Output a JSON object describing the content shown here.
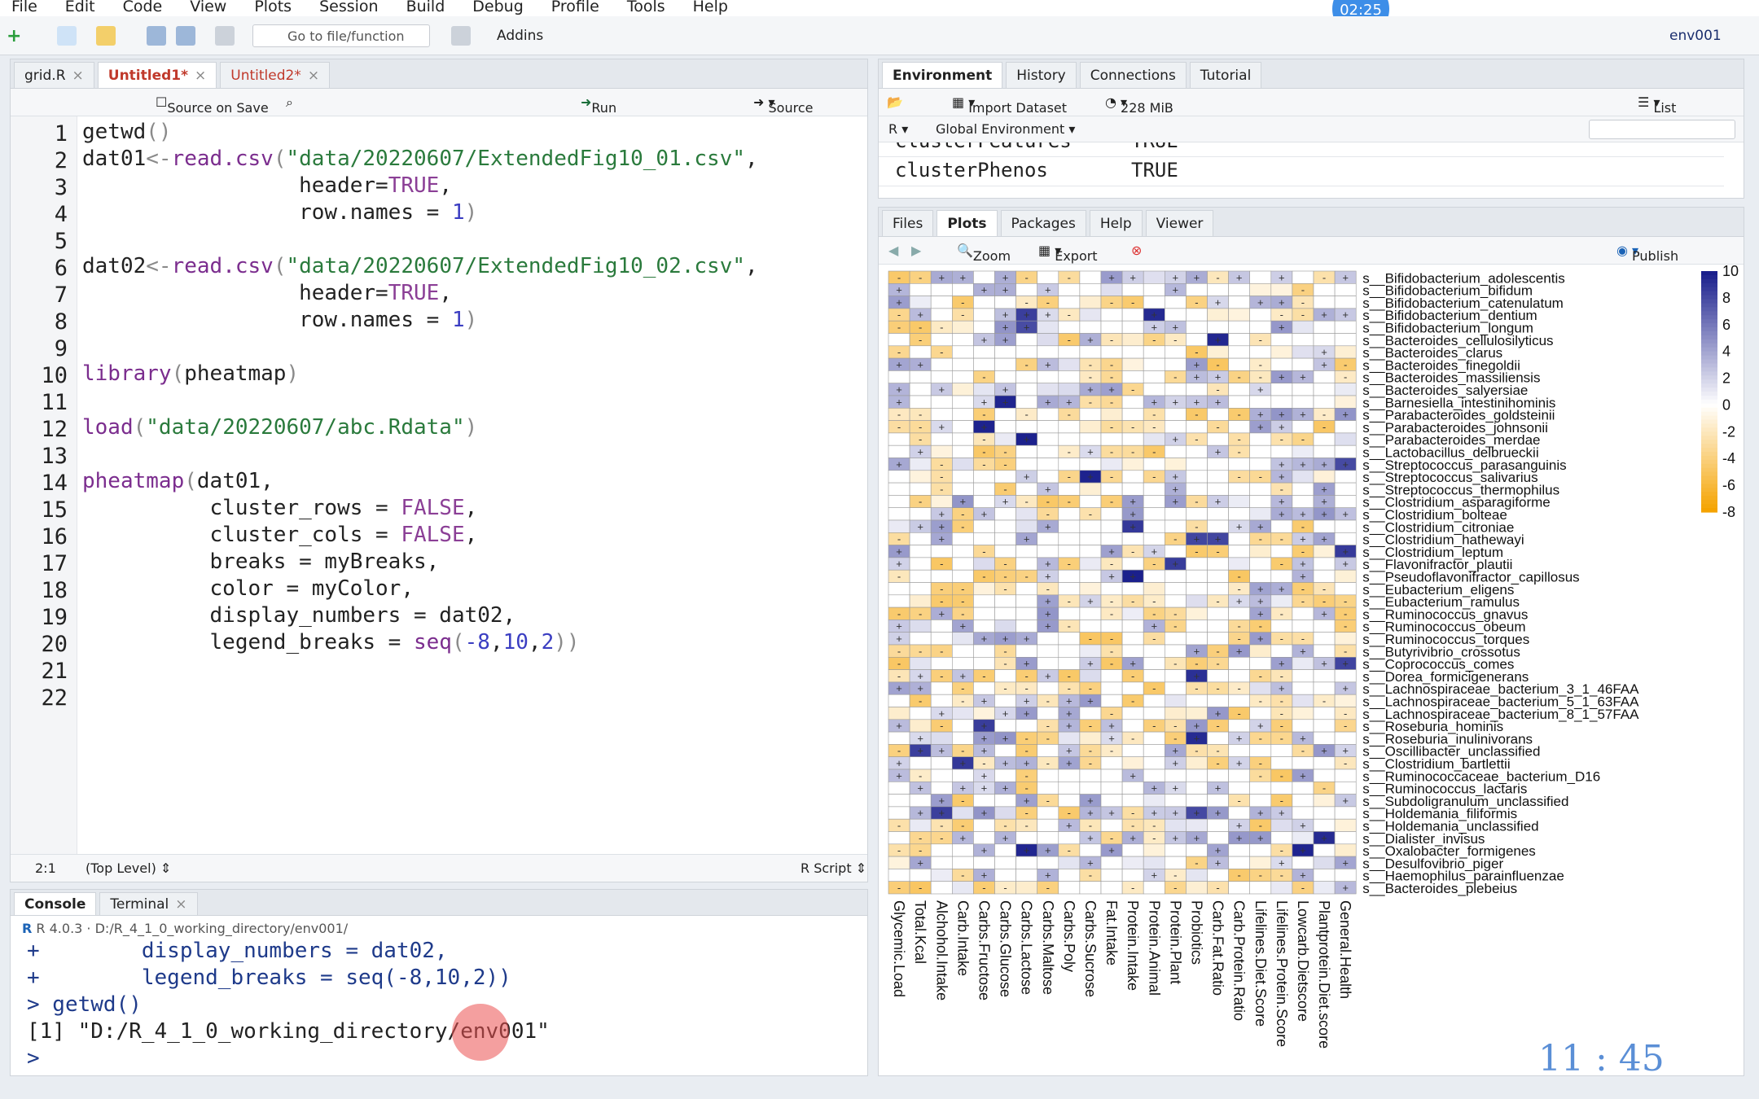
{
  "menu": [
    "File",
    "Edit",
    "Code",
    "View",
    "Plots",
    "Session",
    "Build",
    "Debug",
    "Profile",
    "Tools",
    "Help"
  ],
  "timer_badge": "02:25",
  "toolbar": {
    "goto_placeholder": "Go to file/function",
    "addins": "Addins",
    "project": "env001"
  },
  "editor": {
    "tabs": [
      {
        "label": "grid.R"
      },
      {
        "label": "Untitled1*"
      },
      {
        "label": "Untitled2*"
      }
    ],
    "source_on_save": "Source on Save",
    "run": "Run",
    "source": "Source",
    "status_pos": "2:1",
    "status_scope": "(Top Level)",
    "status_type": "R Script",
    "lines": [
      "1",
      "2",
      "3",
      "4",
      "5",
      "6",
      "7",
      "8",
      "9",
      "10",
      "11",
      "12",
      "13",
      "14",
      "15",
      "16",
      "17",
      "18",
      "19",
      "20",
      "21",
      "22"
    ]
  },
  "console": {
    "tab": "Console",
    "terminal": "Terminal",
    "version": "R 4.0.3",
    "path": "D:/R_4_1_0_working_directory/env001/",
    "lines": [
      "+        display_numbers = dat02,",
      "+        legend_breaks = seq(-8,10,2))",
      "> getwd()",
      "[1] \"D:/R_4_1_0_working_directory/env001\"",
      ">"
    ]
  },
  "env": {
    "tabs": [
      "Environment",
      "History",
      "Connections",
      "Tutorial"
    ],
    "import": "Import Dataset",
    "mem": "228 MiB",
    "list": "List",
    "lang": "R",
    "scope": "Global Environment",
    "rows": [
      {
        "name": "clusterFeatures",
        "value": "TRUE"
      },
      {
        "name": "clusterPhenos",
        "value": "TRUE"
      }
    ]
  },
  "files": {
    "tabs": [
      "Files",
      "Plots",
      "Packages",
      "Help",
      "Viewer"
    ],
    "zoom": "Zoom",
    "export": "Export",
    "publish": "Publish"
  },
  "clock": "11 : 45",
  "chart_data": {
    "type": "heatmap",
    "rows": [
      "s__Bifidobacterium_adolescentis",
      "s__Bifidobacterium_bifidum",
      "s__Bifidobacterium_catenulatum",
      "s__Bifidobacterium_dentium",
      "s__Bifidobacterium_longum",
      "s__Bacteroides_cellulosilyticus",
      "s__Bacteroides_clarus",
      "s__Bacteroides_finegoldii",
      "s__Bacteroides_massiliensis",
      "s__Bacteroides_salyersiae",
      "s__Barnesiella_intestinihominis",
      "s__Parabacteroides_goldsteinii",
      "s__Parabacteroides_johnsonii",
      "s__Parabacteroides_merdae",
      "s__Lactobacillus_delbrueckii",
      "s__Streptococcus_parasanguinis",
      "s__Streptococcus_salivarius",
      "s__Streptococcus_thermophilus",
      "s__Clostridium_asparagiforme",
      "s__Clostridium_bolteae",
      "s__Clostridium_citroniae",
      "s__Clostridium_hathewayi",
      "s__Clostridium_leptum",
      "s__Flavonifractor_plautii",
      "s__Pseudoflavonifractor_capillosus",
      "s__Eubacterium_eligens",
      "s__Eubacterium_ramulus",
      "s__Ruminococcus_gnavus",
      "s__Ruminococcus_obeum",
      "s__Ruminococcus_torques",
      "s__Butyrivibrio_crossotus",
      "s__Coprococcus_comes",
      "s__Dorea_formicigenerans",
      "s__Lachnospiraceae_bacterium_3_1_46FAA",
      "s__Lachnospiraceae_bacterium_5_1_63FAA",
      "s__Lachnospiraceae_bacterium_8_1_57FAA",
      "s__Roseburia_hominis",
      "s__Roseburia_inulinivorans",
      "s__Oscillibacter_unclassified",
      "s__Clostridium_bartlettii",
      "s__Ruminococcaceae_bacterium_D16",
      "s__Ruminococcus_lactaris",
      "s__Subdoligranulum_unclassified",
      "s__Holdemania_filiformis",
      "s__Holdemania_unclassified",
      "s__Dialister_invisus",
      "s__Oxalobacter_formigenes",
      "s__Desulfovibrio_piger",
      "s__Haemophilus_parainfluenzae",
      "s__Bacteroides_plebeius"
    ],
    "columns": [
      "Glycemic.Load",
      "Total.Kcal",
      "Alchohol.Intake",
      "Carb.Intake",
      "Carbs.Fructose",
      "Carbs.Glucose",
      "Carbs.Lactose",
      "Carbs.Maltose",
      "Carbs.Poly",
      "Carbs.Sucrose",
      "Fat.Intake",
      "Protein.Intake",
      "Protein.Animal",
      "Protein.Plant",
      "Probiotics",
      "Carb.Fat.Ratio",
      "Carb.Protein.Ratio",
      "Lifelines.Diet.Score",
      "Lifelines.Protein.Score",
      "Lowcarb.Dietscore",
      "Plantprotein.Diet.score",
      "General.Health"
    ],
    "legend_breaks": [
      10,
      8,
      6,
      4,
      2,
      0,
      -2,
      -4,
      -6,
      -8
    ],
    "range": [
      -8,
      10
    ],
    "low_color": "#f5a300",
    "mid_color": "#ffffff",
    "high_color": "#1a1f8c"
  }
}
